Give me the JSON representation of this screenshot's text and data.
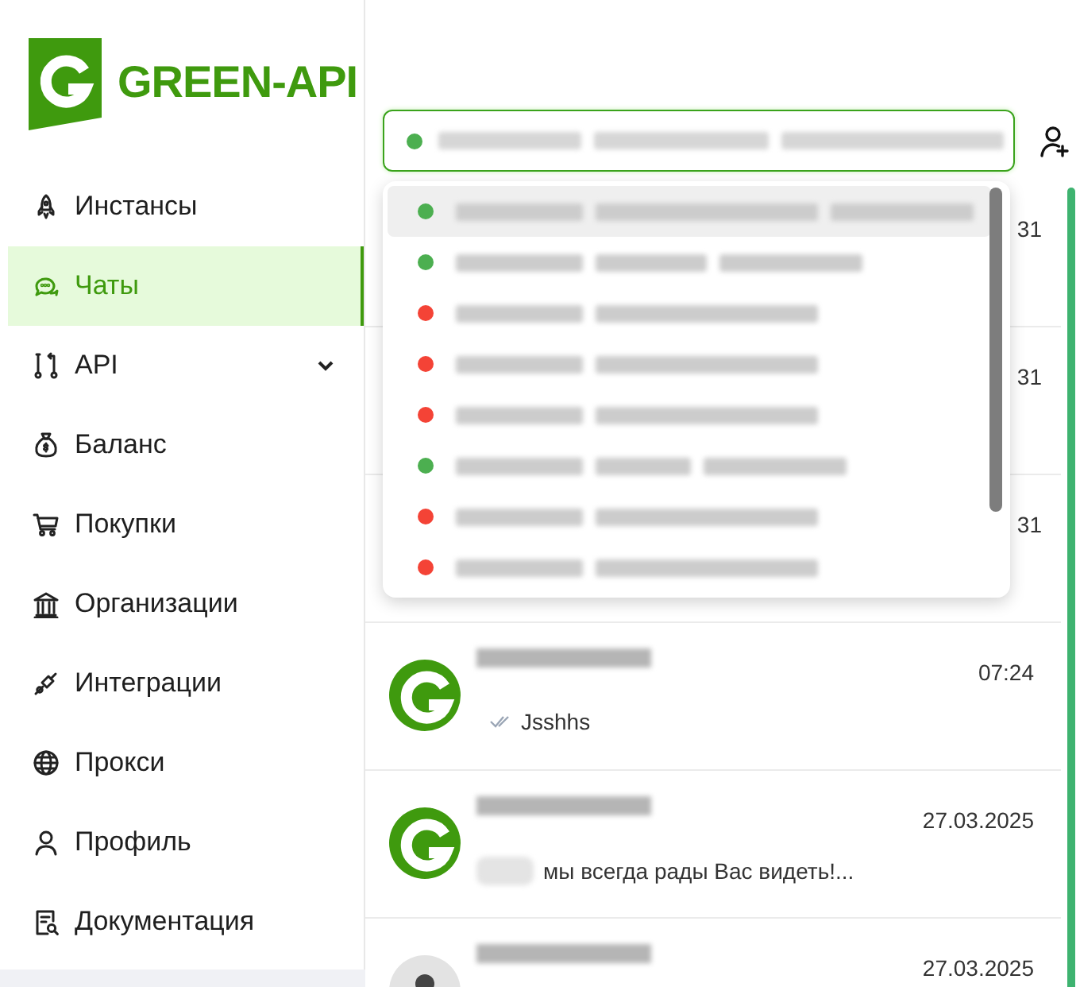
{
  "logo": {
    "text": "GREEN-API"
  },
  "nav": [
    {
      "label": "Инстансы",
      "selected": false
    },
    {
      "label": "Чаты",
      "selected": true
    },
    {
      "label": "API",
      "selected": false,
      "expandable": true
    },
    {
      "label": "Баланс",
      "selected": false
    },
    {
      "label": "Покупки",
      "selected": false
    },
    {
      "label": "Организации",
      "selected": false
    },
    {
      "label": "Интеграции",
      "selected": false
    },
    {
      "label": "Прокси",
      "selected": false
    },
    {
      "label": "Профиль",
      "selected": false
    },
    {
      "label": "Документация",
      "selected": false
    }
  ],
  "instance_picker": {
    "color": "#4caf50",
    "open": true,
    "options": [
      {
        "color": "#4caf50",
        "selected": true
      },
      {
        "color": "#4caf50",
        "selected": false
      },
      {
        "color": "#f44336",
        "selected": false
      },
      {
        "color": "#f44336",
        "selected": false
      },
      {
        "color": "#f44336",
        "selected": false
      },
      {
        "color": "#4caf50",
        "selected": false
      },
      {
        "color": "#f44336",
        "selected": false
      },
      {
        "color": "#f44336",
        "selected": false
      }
    ]
  },
  "chats": [
    {
      "kind": "covered",
      "time": "31"
    },
    {
      "kind": "covered",
      "time": "31"
    },
    {
      "kind": "covered",
      "time": "31"
    },
    {
      "kind": "logo",
      "time": "07:24",
      "preview": "Jsshhs",
      "read_ticks": true
    },
    {
      "kind": "logo",
      "time": "27.03.2025",
      "preview": "мы всегда рады Вас видеть!...",
      "sender_hidden": true
    },
    {
      "kind": "person",
      "time": "27.03.2025"
    }
  ]
}
